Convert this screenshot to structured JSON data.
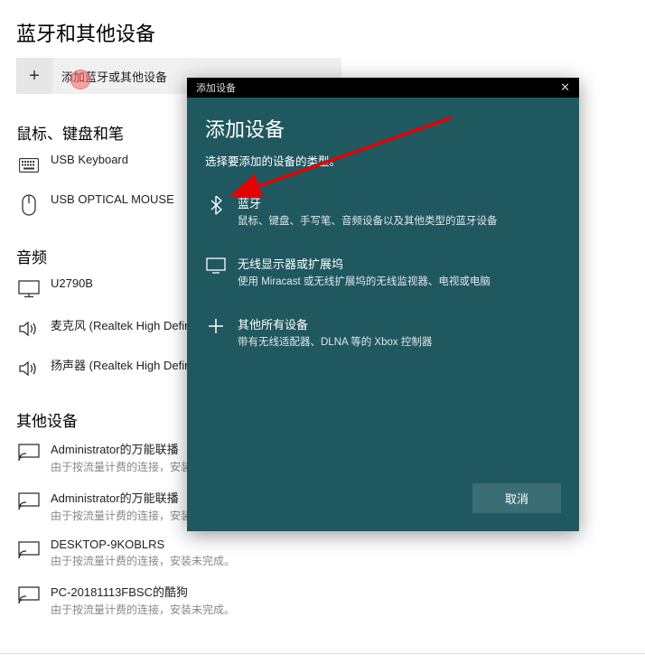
{
  "page": {
    "title": "蓝牙和其他设备",
    "add_bar": {
      "label": "添加蓝牙或其他设备"
    }
  },
  "sections": {
    "input_devices": {
      "header": "鼠标、键盘和笔",
      "items": [
        {
          "name": "USB Keyboard"
        },
        {
          "name": "USB OPTICAL MOUSE"
        }
      ]
    },
    "audio": {
      "header": "音频",
      "items": [
        {
          "name": "U2790B"
        },
        {
          "name": "麦克风 (Realtek High Definition..."
        },
        {
          "name": "扬声器 (Realtek High Definition..."
        }
      ]
    },
    "other": {
      "header": "其他设备",
      "items": [
        {
          "name": "Administrator的万能联播",
          "sub": "由于按流量计费的连接，安装未..."
        },
        {
          "name": "Administrator的万能联播",
          "sub": "由于按流量计费的连接，安装未..."
        },
        {
          "name": "DESKTOP-9KOBLRS",
          "sub": "由于按流量计费的连接，安装未完成。"
        },
        {
          "name": "PC-20181113FBSC的酷狗",
          "sub": "由于按流量计费的连接，安装未完成。"
        }
      ]
    }
  },
  "dialog": {
    "titlebar": "添加设备",
    "heading": "添加设备",
    "subtext": "选择要添加的设备的类型。",
    "options": [
      {
        "title": "蓝牙",
        "desc": "鼠标、键盘、手写笔、音频设备以及其他类型的蓝牙设备"
      },
      {
        "title": "无线显示器或扩展坞",
        "desc": "使用 Miracast 或无线扩展坞的无线监视器、电视或电脑"
      },
      {
        "title": "其他所有设备",
        "desc": "带有无线适配器、DLNA 等的 Xbox 控制器"
      }
    ],
    "cancel": "取消"
  }
}
